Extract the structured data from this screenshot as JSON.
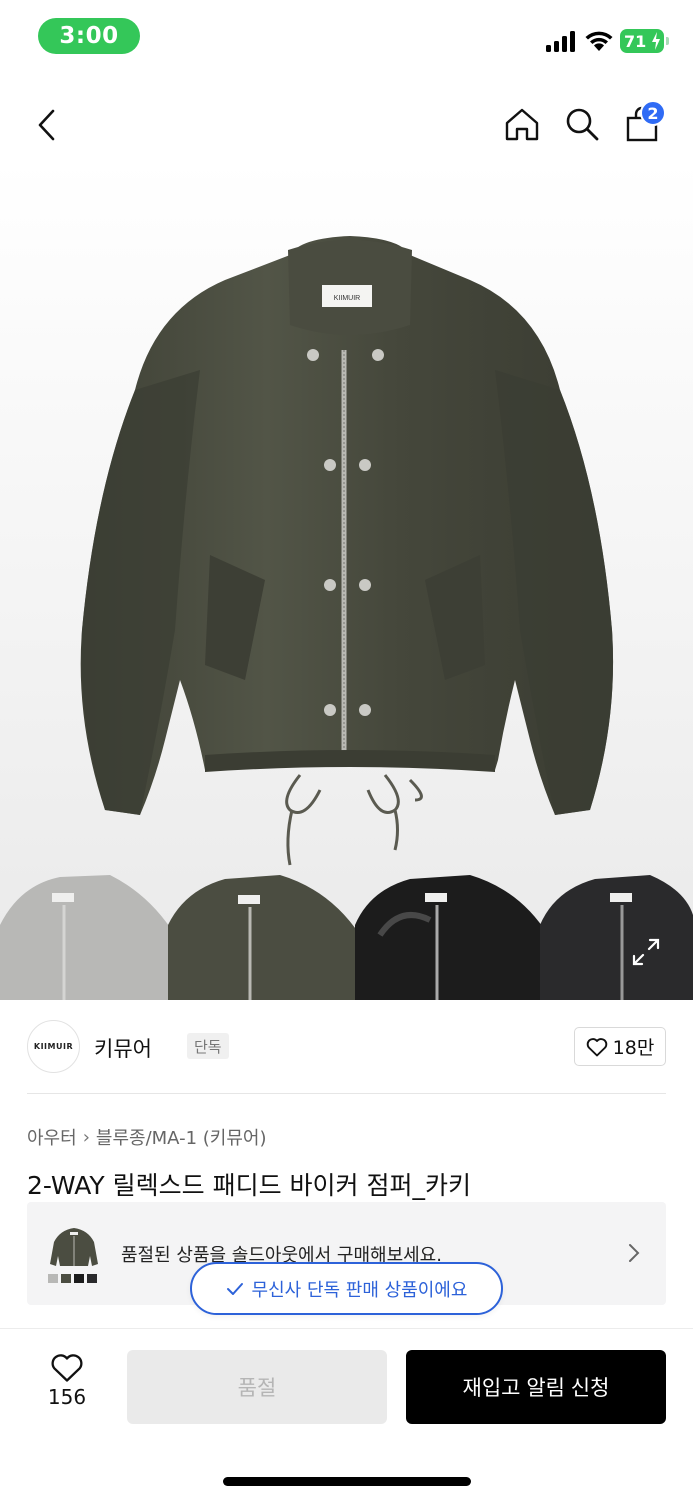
{
  "status_bar": {
    "time": "3:00",
    "battery": "71",
    "icons": [
      "cellular-signal-icon",
      "wifi-icon",
      "battery-charging-icon"
    ]
  },
  "nav": {
    "icons": [
      "back-icon",
      "home-icon",
      "search-icon",
      "shopping-bag-icon"
    ],
    "cart_count": "2"
  },
  "hero": {
    "label_text": "KIIMUIR",
    "thumbnail_colors": [
      "#b8b8b6",
      "#4b4d41",
      "#1c1c1c",
      "#2a2a2c"
    ],
    "expand_icon": "expand-icon"
  },
  "brand": {
    "logo_text": "KIIMUIR",
    "name": "키뮤어",
    "tag": "단독",
    "likes": "18만"
  },
  "product": {
    "breadcrumb": [
      "아우터",
      "블루종/MA-1 (키뮤어)"
    ],
    "title": "2-WAY 릴렉스드 패디드 바이커 점퍼_카키"
  },
  "soldout_banner": {
    "text": "품절된 상품을 솔드아웃에서 구매해보세요."
  },
  "exclusive_badge": {
    "text": "무신사 단독 판매 상품이에요"
  },
  "bottom_bar": {
    "wish_count": "156",
    "soldout_label": "품절",
    "restock_label": "재입고 알림 신청"
  },
  "colors": {
    "accent_blue": "#2d62d9",
    "status_green": "#34c759",
    "jacket_khaki": "#4b4d41"
  }
}
